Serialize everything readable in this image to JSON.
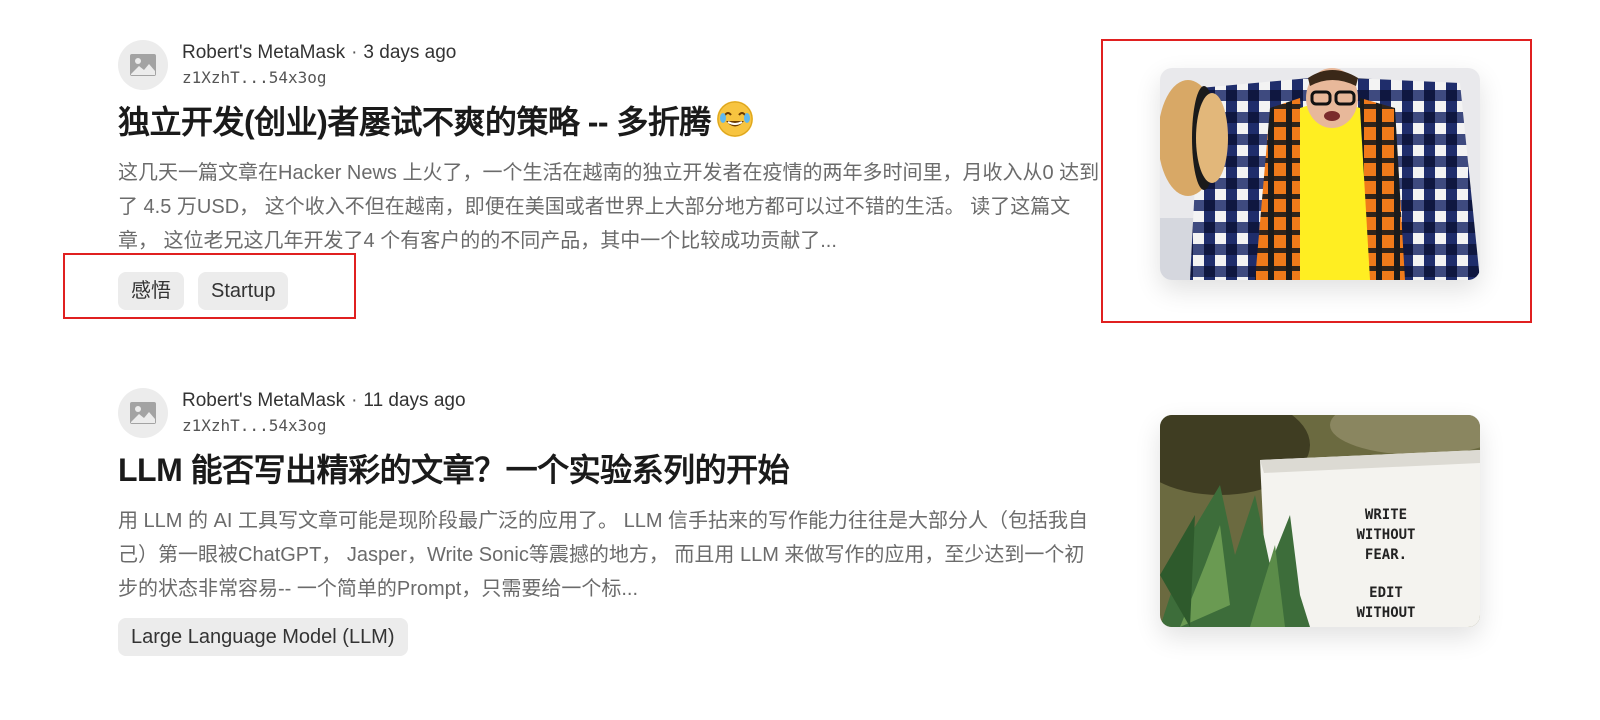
{
  "posts": [
    {
      "author": "Robert's MetaMask",
      "separator": "·",
      "time_ago": "3 days ago",
      "address": "z1XzhT...54x3og",
      "title": "独立开发(创业)者屡试不爽的策略 -- 多折腾",
      "title_emoji": "face-with-tears-of-joy-emoji",
      "excerpt": "这几天一篇文章在Hacker News 上火了，一个生活在越南的独立开发者在疫情的两年多时间里，月收入从0 达到了 4.5 万USD， 这个收入不但在越南，即便在美国或者世界上大部分地方都可以过不错的生活。 读了这篇文章， 这位老兄这几年开发了4 个有客户的的不同产品，其中一个比较成功贡献了...",
      "tags": [
        "感悟",
        "Startup"
      ],
      "thumbnail_icon": "man-in-plaid-shirt-photo"
    },
    {
      "author": "Robert's MetaMask",
      "separator": "·",
      "time_ago": "11 days ago",
      "address": "z1XzhT...54x3og",
      "title": "LLM 能否写出精彩的文章？一个实验系列的开始",
      "excerpt": "用 LLM 的 AI 工具写文章可能是现阶段最广泛的应用了。 LLM 信手拈来的写作能力往往是大部分人（包括我自己）第一眼被ChatGPT， Jasper，Write Sonic等震撼的地方， 而且用 LLM 来做写作的应用，至少达到一个初步的状态非常容易-- 一个简单的Prompt，只需要给一个标...",
      "tags": [
        "Large Language Model (LLM)"
      ],
      "thumbnail_icon": "write-without-fear-photo",
      "thumbnail_text": [
        "WRITE",
        "WITHOUT",
        "FEAR.",
        "EDIT",
        "WITHOUT"
      ]
    }
  ],
  "colors": {
    "highlight": "#e02020",
    "tag_bg": "#ececec",
    "excerpt": "#6b6b6b"
  }
}
